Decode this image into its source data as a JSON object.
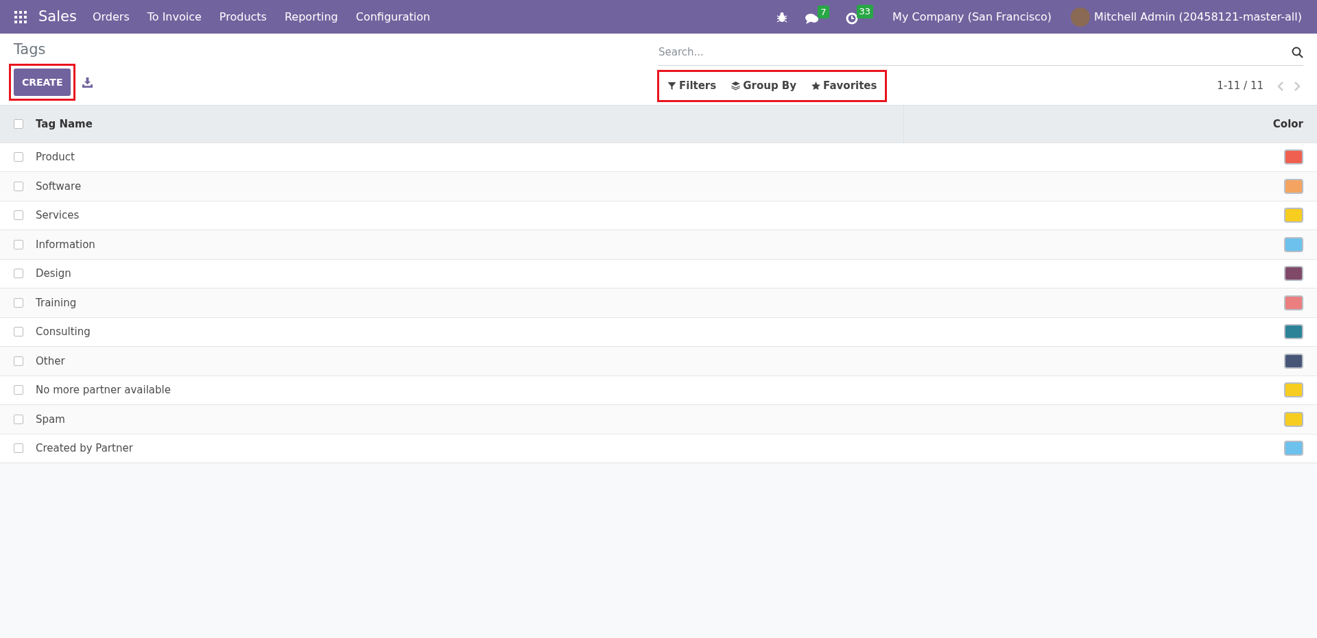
{
  "navbar": {
    "app_name": "Sales",
    "menu": [
      "Orders",
      "To Invoice",
      "Products",
      "Reporting",
      "Configuration"
    ],
    "messages_count": "7",
    "activities_count": "33",
    "company": "My Company (San Francisco)",
    "user": "Mitchell Admin (20458121-master-all)"
  },
  "breadcrumb": "Tags",
  "create_button": "CREATE",
  "search": {
    "placeholder": "Search..."
  },
  "search_options": [
    "Filters",
    "Group By",
    "Favorites"
  ],
  "pager": "1-11 / 11",
  "table": {
    "select_all_checked": false,
    "columns": [
      "Tag Name",
      "Color"
    ],
    "rows": [
      {
        "name": "Product",
        "color": "#f06050",
        "selected": false
      },
      {
        "name": "Software",
        "color": "#f4a460",
        "selected": false
      },
      {
        "name": "Services",
        "color": "#f7cd1f",
        "selected": false
      },
      {
        "name": "Information",
        "color": "#6cc1ed",
        "selected": false
      },
      {
        "name": "Design",
        "color": "#814968",
        "selected": false
      },
      {
        "name": "Training",
        "color": "#eb7e7f",
        "selected": false
      },
      {
        "name": "Consulting",
        "color": "#2c8397",
        "selected": false
      },
      {
        "name": "Other",
        "color": "#475577",
        "selected": false
      },
      {
        "name": "No more partner available",
        "color": "#f7cd1f",
        "selected": false
      },
      {
        "name": "Spam",
        "color": "#f7cd1f",
        "selected": false
      },
      {
        "name": "Created by Partner",
        "color": "#6cc1ed",
        "selected": false
      }
    ]
  }
}
